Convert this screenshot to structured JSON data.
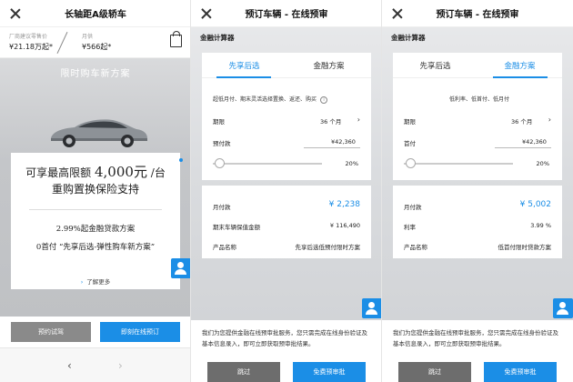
{
  "screen1": {
    "title": "长轴距A级轿车",
    "msrp_label": "厂商建议零售价",
    "msrp_value": "¥21.18万起*",
    "monthly_label": "月供",
    "monthly_value": "¥566起*",
    "promo_heading": "限时购车新方案",
    "promo_line1_prefix": "可享最高限额",
    "promo_line1_amount": "4,000元",
    "promo_line1_suffix": "/台",
    "promo_line2": "重购置换保险支持",
    "promo_sub1": "2.99%起金融贷款方案",
    "promo_sub2": "0首付 “先享后选-弹性购车新方案”",
    "learn_more": "了解更多",
    "btn_test_drive": "预约试驾",
    "btn_order": "即刻在线预订",
    "nav_back": "‹",
    "nav_forward": "›"
  },
  "screen2": {
    "title": "预订车辆 - 在线预审",
    "calc_title": "金融计算器",
    "tab1": "先享后选",
    "tab2": "金融方案",
    "desc": "超低月付、期末灵活选择置换、返还、购买",
    "info": "i",
    "term_label": "期限",
    "term_value": "36 个月",
    "down_label": "预付款",
    "down_value": "¥42,360",
    "pct": "20%",
    "monthly_label": "月付款",
    "monthly_value": "¥ 2,238",
    "residual_label": "期末车辆保值金额",
    "residual_value": "¥ 116,490",
    "product_label": "产品名称",
    "product_value": "先享后选低预付限时方案",
    "notice": "我们为您提供金融在线预审批服务，您只需完成在线身份验证及基本信息录入，即可立即获取预审批结果。",
    "btn_skip": "跳过",
    "btn_free": "免费预审批"
  },
  "screen3": {
    "title": "预订车辆 - 在线预审",
    "calc_title": "金融计算器",
    "tab1": "先享后选",
    "tab2": "金融方案",
    "desc": "低利率、低首付、低月付",
    "term_label": "期限",
    "term_value": "36 个月",
    "down_label": "首付",
    "down_value": "¥42,360",
    "pct": "20%",
    "monthly_label": "月付款",
    "monthly_value": "¥ 5,002",
    "rate_label": "利率",
    "rate_value": "3.99 %",
    "product_label": "产品名称",
    "product_value": "低首付限时贷款方案",
    "notice": "我们为您提供金融在线预审批服务，您只需完成在线身份验证及基本信息录入，即可立即获取预审批结果。",
    "btn_skip": "跳过",
    "btn_free": "免费预审批"
  },
  "colors": {
    "accent": "#1b8ee6",
    "grey_button": "#8a8a8a"
  }
}
